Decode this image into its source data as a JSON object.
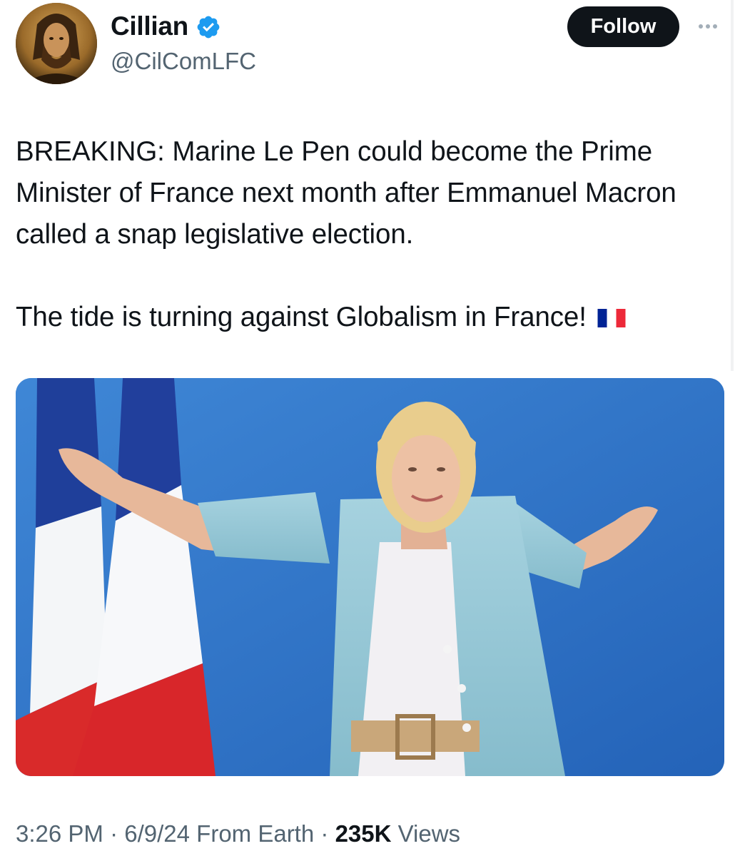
{
  "author": {
    "display_name": "Cillian",
    "handle": "@CilComLFC",
    "verified": true,
    "avatar_icon": "icon-portrait-avatar"
  },
  "actions": {
    "follow_label": "Follow",
    "more_icon": "more-horizontal-icon"
  },
  "tweet": {
    "paragraph_1": "BREAKING: Marine Le Pen could become the Prime Minister of France next month after Emmanuel Macron called a snap legislative election.",
    "paragraph_2": "The tide is turning against Globalism in France!",
    "emoji": "flag-france-icon"
  },
  "media": {
    "type": "photo"
  },
  "meta": {
    "time": "3:26 PM",
    "separator": "·",
    "date": "6/9/24",
    "source": "From Earth",
    "views_count": "235K",
    "views_label": "Views"
  },
  "colors": {
    "text_primary": "#0f1419",
    "text_secondary": "#536471",
    "verified_blue": "#1d9bf0",
    "follow_bg": "#0f1419",
    "follow_text": "#ffffff"
  }
}
